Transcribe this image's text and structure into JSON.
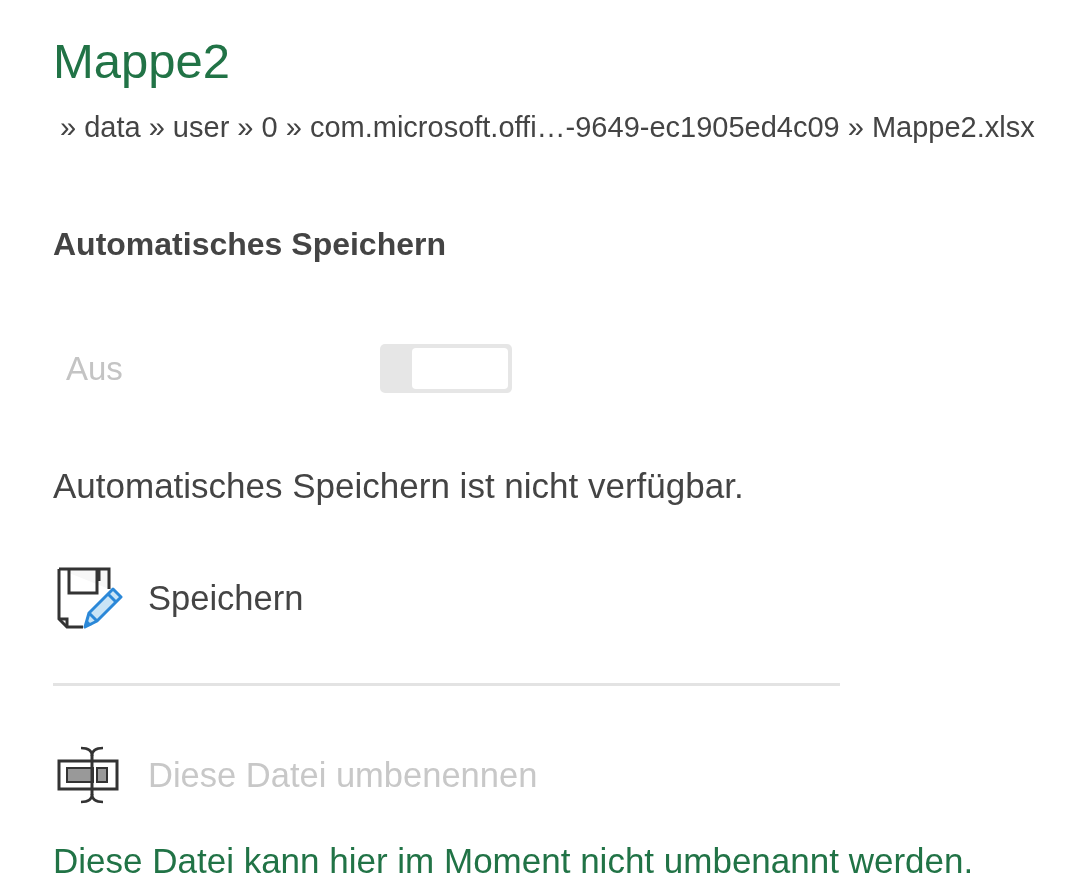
{
  "title": "Mappe2",
  "path": "» data » user » 0 » com.microsoft.offi…-9649-ec1905ed4c09 » Mappe2.xlsx",
  "autosave": {
    "heading": "Automatisches Speichern",
    "toggle": {
      "label": "Aus",
      "on": false,
      "disabled": true
    },
    "note": "Automatisches Speichern ist nicht verfügbar."
  },
  "actions": [
    {
      "kind": "save",
      "label": "Speichern",
      "disabled": false
    },
    {
      "kind": "rename",
      "label": "Diese Datei umbenennen",
      "disabled": true
    }
  ],
  "rename_message": "Diese Datei kann hier im Moment nicht umbenannt werden."
}
